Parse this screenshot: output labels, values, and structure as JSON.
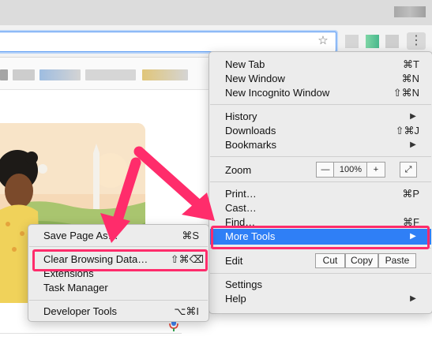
{
  "app": {
    "accent": "#2f7ff6",
    "highlight": "#ff2c6b"
  },
  "toolbar": {
    "bookmark_star_icon": "star-icon",
    "menu_icon": "vertical-ellipsis-icon"
  },
  "main_menu": {
    "new_tab": {
      "label": "New Tab",
      "shortcut": "⌘T"
    },
    "new_window": {
      "label": "New Window",
      "shortcut": "⌘N"
    },
    "new_incognito": {
      "label": "New Incognito Window",
      "shortcut": "⇧⌘N"
    },
    "history": {
      "label": "History"
    },
    "downloads": {
      "label": "Downloads",
      "shortcut": "⇧⌘J"
    },
    "bookmarks": {
      "label": "Bookmarks"
    },
    "zoom": {
      "label": "Zoom",
      "minus": "—",
      "value": "100%",
      "plus": "+"
    },
    "print": {
      "label": "Print…",
      "shortcut": "⌘P"
    },
    "cast": {
      "label": "Cast…"
    },
    "find": {
      "label": "Find…",
      "shortcut": "⌘F"
    },
    "more_tools": {
      "label": "More Tools"
    },
    "edit": {
      "label": "Edit",
      "cut": "Cut",
      "copy": "Copy",
      "paste": "Paste"
    },
    "settings": {
      "label": "Settings"
    },
    "help": {
      "label": "Help"
    }
  },
  "sub_menu": {
    "save_page": {
      "label": "Save Page As…",
      "shortcut": "⌘S"
    },
    "clear_browsing": {
      "label": "Clear Browsing Data…",
      "shortcut": "⇧⌘⌫"
    },
    "extensions": {
      "label": "Extensions"
    },
    "task_manager": {
      "label": "Task Manager"
    },
    "developer_tools": {
      "label": "Developer Tools",
      "shortcut": "⌥⌘I"
    }
  }
}
